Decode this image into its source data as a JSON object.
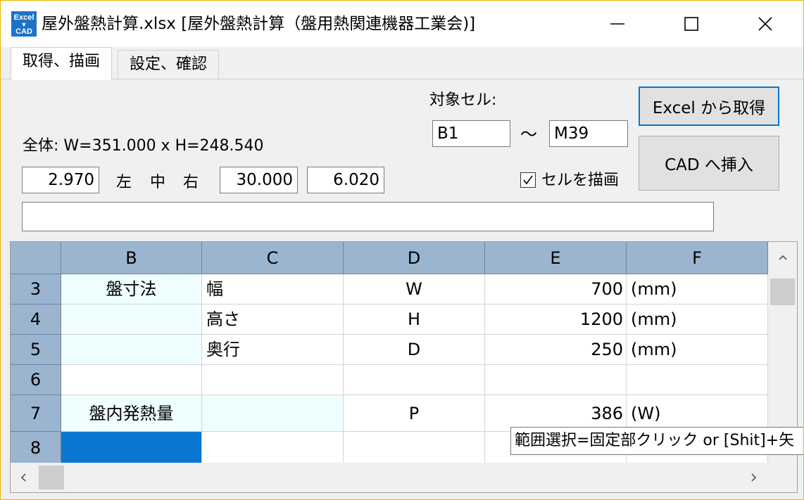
{
  "window": {
    "icon": {
      "name": "excel-cad-app-icon",
      "line1": "Excel",
      "line2": "CAD"
    },
    "title": "屋外盤熱計算.xlsx [屋外盤熱計算（盤用熱関連機器工業会)]",
    "controls": {
      "minimize": "minimize-icon",
      "maximize": "maximize-icon",
      "close": "close-icon"
    }
  },
  "tabs": [
    {
      "label": "取得、描画",
      "active": true
    },
    {
      "label": "設定、確認",
      "active": false
    }
  ],
  "panel": {
    "target_cell_label": "対象セル:",
    "range_from": "B1",
    "range_tilde": "～",
    "range_to": "M39",
    "overall_size": "全体: W=351.000 x H=248.540",
    "left_value": "2.970",
    "align_left": "左",
    "align_center": "中",
    "align_right": "右",
    "value_middle": "30.000",
    "value_right": "6.020",
    "draw_cells_checked": true,
    "draw_cells_label": "セルを描画",
    "text_field_value": "",
    "get_from_excel_button": "Excel から取得",
    "insert_to_cad_button": "CAD へ挿入"
  },
  "grid": {
    "columns": [
      "B",
      "C",
      "D",
      "E",
      "F"
    ],
    "rows": [
      {
        "num": "3",
        "cells": [
          "盤寸法",
          "幅",
          "W",
          "700",
          "(mm)"
        ]
      },
      {
        "num": "4",
        "cells": [
          "",
          "高さ",
          "H",
          "1200",
          "(mm)"
        ]
      },
      {
        "num": "5",
        "cells": [
          "",
          "奥行",
          "D",
          "250",
          "(mm)"
        ]
      },
      {
        "num": "6",
        "cells": [
          "",
          "",
          "",
          "",
          ""
        ]
      },
      {
        "num": "7",
        "cells": [
          "盤内発熱量",
          "",
          "P",
          "386",
          "(W)"
        ]
      },
      {
        "num": "8",
        "cells": [
          "",
          "",
          "",
          "",
          ""
        ]
      }
    ],
    "selected_cell": "B8"
  },
  "scrollbars": {
    "up_icon": "chevron-up-icon",
    "left_icon": "chevron-left-icon",
    "right_icon": "chevron-right-icon"
  },
  "tooltip": "範囲選択=固定部クリック or [Shit]+矢"
}
